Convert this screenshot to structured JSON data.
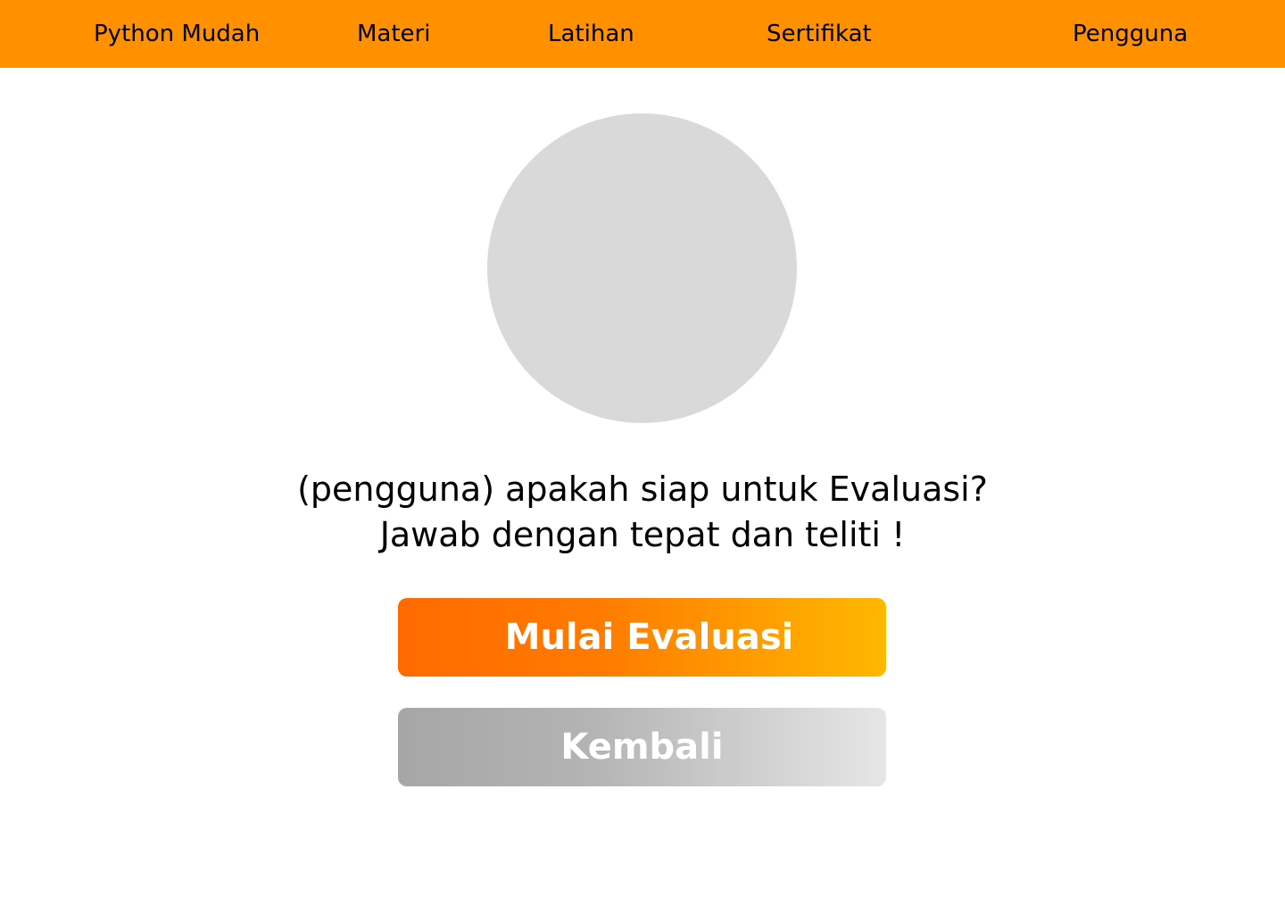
{
  "navbar": {
    "brand": "Python Mudah",
    "items": [
      {
        "label": "Materi"
      },
      {
        "label": "Latihan"
      },
      {
        "label": "Sertifikat"
      },
      {
        "label": "Pengguna"
      }
    ],
    "background_color": "#ff9100"
  },
  "avatar": {
    "icon": "avatar-placeholder",
    "color": "#d9d9d9"
  },
  "prompt": {
    "line1": "(pengguna) apakah siap untuk Evaluasi?",
    "line2": "Jawab dengan tepat dan teliti !"
  },
  "buttons": {
    "start_label": "Mulai Evaluasi",
    "back_label": "Kembali",
    "start_gradient": [
      "#ff6a00",
      "#ffb800"
    ],
    "back_gradient": [
      "#a6a6a6",
      "#e6e6e6"
    ]
  }
}
